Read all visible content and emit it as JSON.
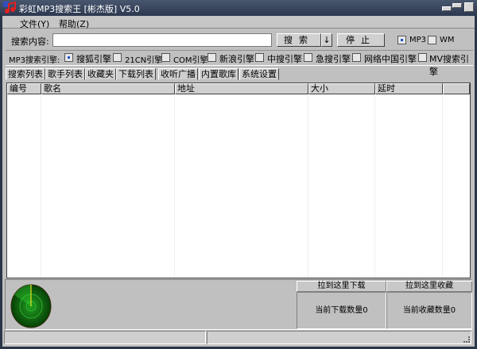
{
  "window": {
    "title": "彩虹MP3搜索王 [彬杰版] V5.0"
  },
  "menu": [
    {
      "label": "文件(Y)"
    },
    {
      "label": "帮助(Z)"
    }
  ],
  "search": {
    "label": "搜索内容:",
    "value": "",
    "search_button": "搜索",
    "dropdown_arrow": "↓",
    "stop_button": "停止",
    "formats": [
      {
        "label": "MP3",
        "checked": true
      },
      {
        "label": "WM",
        "checked": false
      }
    ]
  },
  "engines": {
    "label": "MP3搜索引擎:",
    "items": [
      {
        "label": "搜狐引擎",
        "checked": true
      },
      {
        "label": "21CN引擎",
        "checked": false
      },
      {
        "label": "COM引擎",
        "checked": false
      },
      {
        "label": "新浪引擎",
        "checked": false
      },
      {
        "label": "中搜引擎",
        "checked": false
      },
      {
        "label": "急搜引擎",
        "checked": false
      },
      {
        "label": "网络中国引擎",
        "checked": false
      },
      {
        "label": "MV搜索引擎",
        "checked": false
      }
    ]
  },
  "tabs": [
    {
      "label": "搜索列表",
      "active": true
    },
    {
      "label": "歌手列表"
    },
    {
      "label": "收藏夹"
    },
    {
      "label": "下载列表"
    },
    {
      "label": "收听广播"
    },
    {
      "label": "内置歌库"
    },
    {
      "label": "系统设置"
    }
  ],
  "table": {
    "columns": [
      "编号",
      "歌名",
      "地址",
      "大小",
      "延时",
      ""
    ],
    "rows": []
  },
  "bottom": {
    "download_drop": "拉到这里下载",
    "favorite_drop": "拉到这里收藏",
    "download_count": "当前下载数量0",
    "favorite_count": "当前收藏数量0"
  },
  "colors": {
    "radar": "#1a9a1a",
    "titlebar": "#2c3850"
  }
}
